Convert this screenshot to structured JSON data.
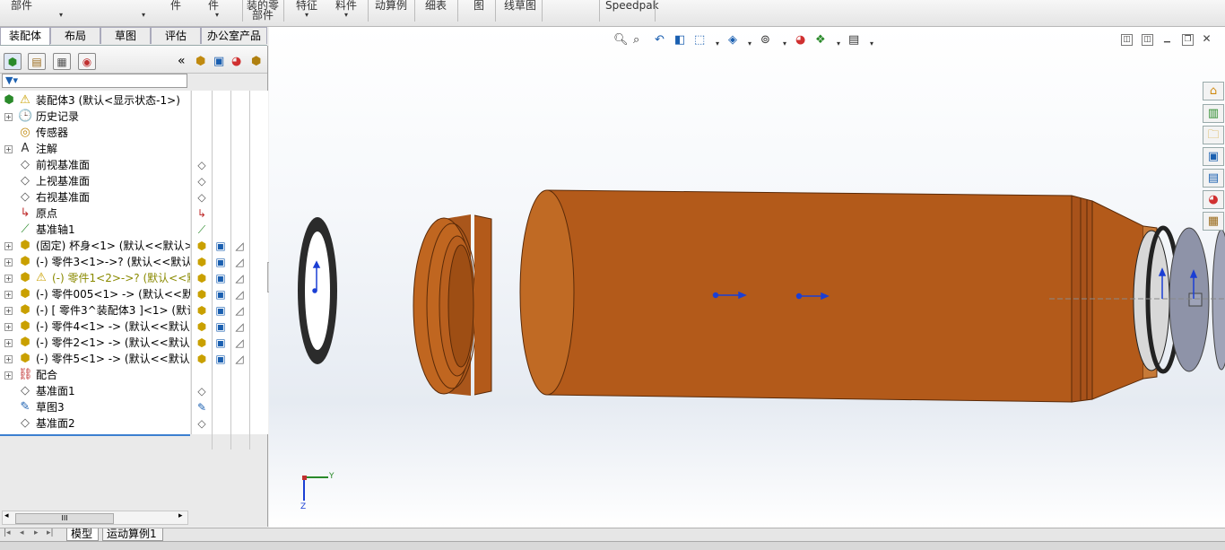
{
  "ribbon": {
    "items": [
      "部件",
      "件",
      "",
      "",
      "",
      "件",
      "装配零部件",
      "特征",
      "材料",
      "动算例",
      "细表",
      "图",
      "线草图",
      "",
      "Speedpak"
    ]
  },
  "ribbon_labels": {
    "r1": "部件",
    "r2": "件",
    "r3": "件",
    "r4a": "装的零",
    "r4b": "部件",
    "r5": "特征",
    "r6": "料件",
    "r7": "动算例",
    "r8": "细表",
    "r9": "图",
    "r10": "线草图",
    "r11": "Speedpak"
  },
  "tabs": [
    {
      "label": "装配体"
    },
    {
      "label": "布局"
    },
    {
      "label": "草图"
    },
    {
      "label": "评估"
    },
    {
      "label": "办公室产品"
    }
  ],
  "collapse_label": "«",
  "tree": {
    "root": "装配体3 (默认<显示状态-1>)",
    "items": [
      {
        "label": "历史记录",
        "icon": "history-icon"
      },
      {
        "label": "传感器",
        "icon": "sensor-icon"
      },
      {
        "label": "注解",
        "icon": "annotation-icon"
      },
      {
        "label": "前视基准面",
        "icon": "plane-icon"
      },
      {
        "label": "上视基准面",
        "icon": "plane-icon"
      },
      {
        "label": "右视基准面",
        "icon": "plane-icon"
      },
      {
        "label": "原点",
        "icon": "origin-icon"
      },
      {
        "label": "基准轴1",
        "icon": "axis-icon"
      },
      {
        "label": "(固定) 杯身<1> (默认<<默认>_",
        "icon": "part-icon"
      },
      {
        "label": "(-) 零件3<1>->? (默认<<默认>",
        "icon": "part-icon"
      },
      {
        "label": "(-) 零件1<2>->? (默认<<默认",
        "icon": "part-warning-icon"
      },
      {
        "label": "(-) 零件005<1> -> (默认<<默认",
        "icon": "part-icon"
      },
      {
        "label": "(-) [ 零件3^装配体3 ]<1> (默认",
        "icon": "part-icon"
      },
      {
        "label": "(-) 零件4<1> -> (默认<<默认>",
        "icon": "part-icon"
      },
      {
        "label": "(-) 零件2<1> -> (默认<<默认>",
        "icon": "part-icon"
      },
      {
        "label": "(-) 零件5<1> -> (默认<<默认>",
        "icon": "part-icon"
      },
      {
        "label": "配合",
        "icon": "mates-icon"
      },
      {
        "label": "基准面1",
        "icon": "plane-icon"
      },
      {
        "label": "草图3",
        "icon": "sketch-icon"
      },
      {
        "label": "基准面2",
        "icon": "plane-icon"
      }
    ]
  },
  "scroll_thumb": "III",
  "axis_triad": {
    "y": "Y",
    "z": "Z"
  },
  "bottom_tabs": [
    {
      "label": "模型"
    },
    {
      "label": "运动算例1"
    }
  ],
  "colors": {
    "part_orange": "#b35a1a",
    "part_orange_light": "#d0742a",
    "ring_dark": "#2b2b2b",
    "disc_grey": "#8e93a8",
    "axis_blue": "#1b3fd4"
  }
}
